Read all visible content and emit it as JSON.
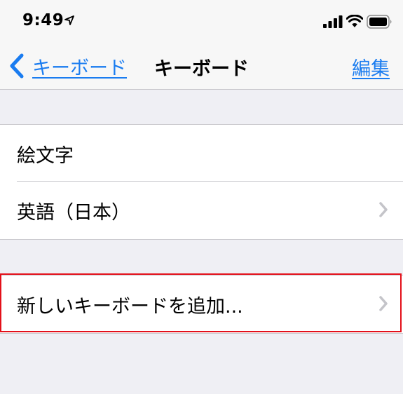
{
  "status_bar": {
    "time": "9:49"
  },
  "nav": {
    "back_label": "キーボード",
    "title": "キーボード",
    "edit_label": "編集"
  },
  "keyboards": [
    {
      "label": "絵文字",
      "has_chevron": false
    },
    {
      "label": "英語（日本）",
      "has_chevron": true
    }
  ],
  "add_keyboard": {
    "label": "新しいキーボードを追加..."
  },
  "colors": {
    "accent": "#1a7cf0",
    "background": "#efeff4",
    "highlight": "#e3101a"
  }
}
